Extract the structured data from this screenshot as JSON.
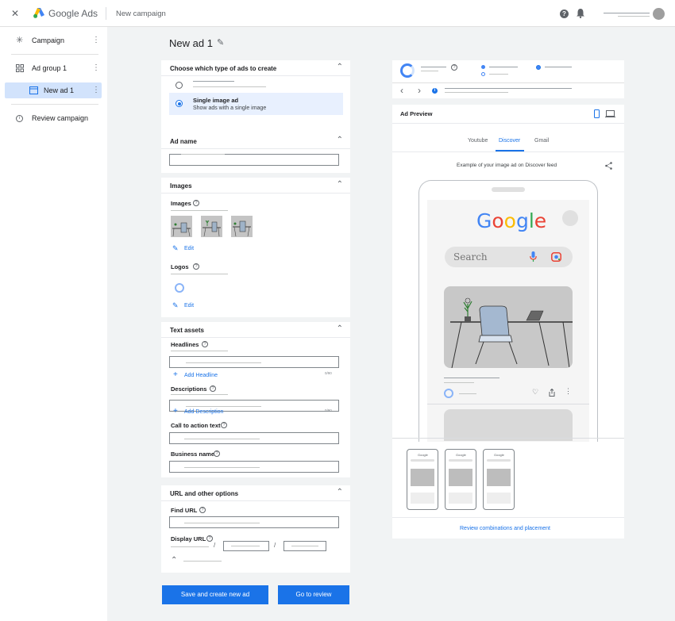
{
  "topbar": {
    "close_glyph": "✕",
    "app_name": "Google Ads",
    "page": "New campaign",
    "help_glyph": "?",
    "bell_glyph": "🔔"
  },
  "sidebar": {
    "items": [
      {
        "label": "Campaign",
        "icon": "asterisk-icon"
      },
      {
        "label": "Ad group 1",
        "icon": "grid-icon"
      },
      {
        "label": "New ad 1",
        "icon": "window-icon"
      },
      {
        "label": "Review campaign",
        "icon": "info-icon"
      }
    ],
    "more_glyph": "⋮"
  },
  "editor": {
    "title": "New ad 1",
    "edit_glyph": "✎",
    "chevron_up": "⌃",
    "ad_type": {
      "title": "Choose which type of ads to create",
      "selected_title": "Single image ad",
      "selected_desc": "Show ads with a single image"
    },
    "ad_name": {
      "title": "Ad name"
    },
    "images": {
      "title": "Images",
      "images_label": "Images",
      "logos_label": "Logos",
      "edit_label": "Edit",
      "pencil_glyph": "✎"
    },
    "text_assets": {
      "title": "Text assets",
      "headlines_label": "Headlines",
      "add_headline": "Add Headline",
      "descriptions_label": "Descriptions",
      "add_description": "Add Description",
      "cta_label": "Call to action text",
      "business_label": "Business name",
      "plus_glyph": "+",
      "counter_headline": "0/90",
      "counter_desc": "0/90"
    },
    "url_options": {
      "title": "URL and other options",
      "final_url_label": "Find URL",
      "display_url_label": "Display URL",
      "slash": "/"
    },
    "help_glyph": "?",
    "buttons": {
      "save_create": "Save and create new ad",
      "go_review": "Go to review"
    }
  },
  "preview": {
    "title": "Ad Preview",
    "tabs": [
      "Youtube",
      "Discover",
      "Gmail"
    ],
    "active_tab": "Discover",
    "example_text": "Example of your image ad on Discover feed",
    "google_letters": [
      "G",
      "o",
      "o",
      "g",
      "l",
      "e"
    ],
    "search_placeholder": "Search",
    "review_link": "Review combinations and placement",
    "nav_back": "‹",
    "nav_forward": "›",
    "info_glyph": "i",
    "share_glyph": "⋖",
    "heart_glyph": "♡",
    "more_glyph": "⋮"
  },
  "colors": {
    "accent": "#1a73e8",
    "google_blue": "#4285f4",
    "google_red": "#ea4335",
    "google_yellow": "#fbbc05",
    "google_green": "#34a853"
  }
}
